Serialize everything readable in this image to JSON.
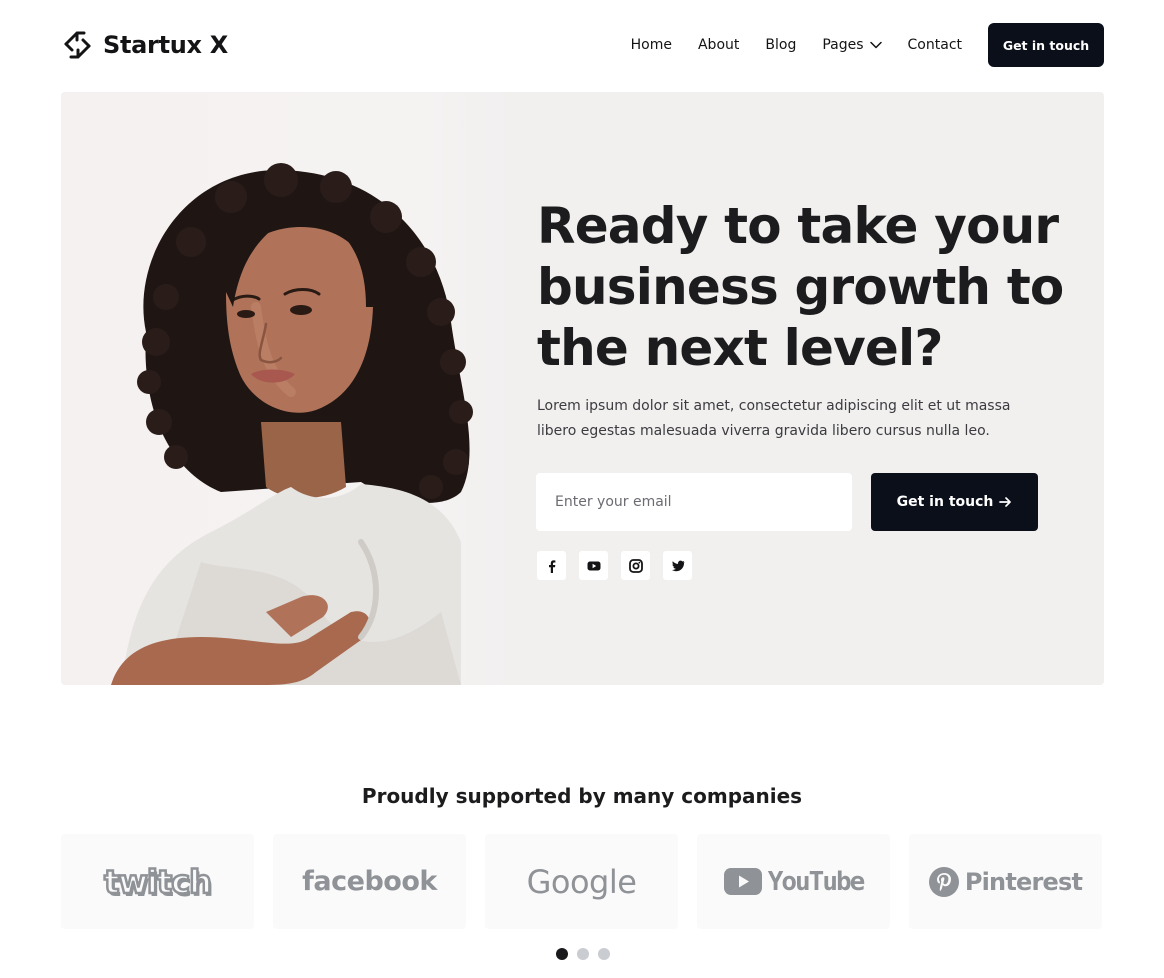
{
  "brand": {
    "name": "Startux X",
    "logo_icon": "link-arrow-icon"
  },
  "nav": {
    "items": [
      {
        "label": "Home"
      },
      {
        "label": "About"
      },
      {
        "label": "Blog"
      },
      {
        "label": "Pages",
        "icon": "chevron-down-icon"
      },
      {
        "label": "Contact"
      }
    ],
    "cta_label": "Get in touch"
  },
  "hero": {
    "title": "Ready to take your business growth to the next level?",
    "description": "Lorem ipsum dolor sit amet, consectetur adipiscing elit et ut massa libero egestas malesuada viverra gravida libero cursus nulla leo.",
    "email_placeholder": "Enter your email",
    "cta_label": "Get in touch",
    "cta_icon": "arrow-right-icon",
    "social": [
      "facebook-icon",
      "youtube-icon",
      "instagram-icon",
      "twitter-icon"
    ]
  },
  "companies": {
    "title": "Proudly supported by many companies",
    "logos": [
      "twitch",
      "facebook",
      "Google",
      "YouTube",
      "Pinterest"
    ],
    "dots": {
      "count": 3,
      "active": 1
    }
  },
  "colors": {
    "primary": "#0b0f19",
    "hero_bg": "#f1f0ef",
    "logo_gray": "#8f9296"
  }
}
